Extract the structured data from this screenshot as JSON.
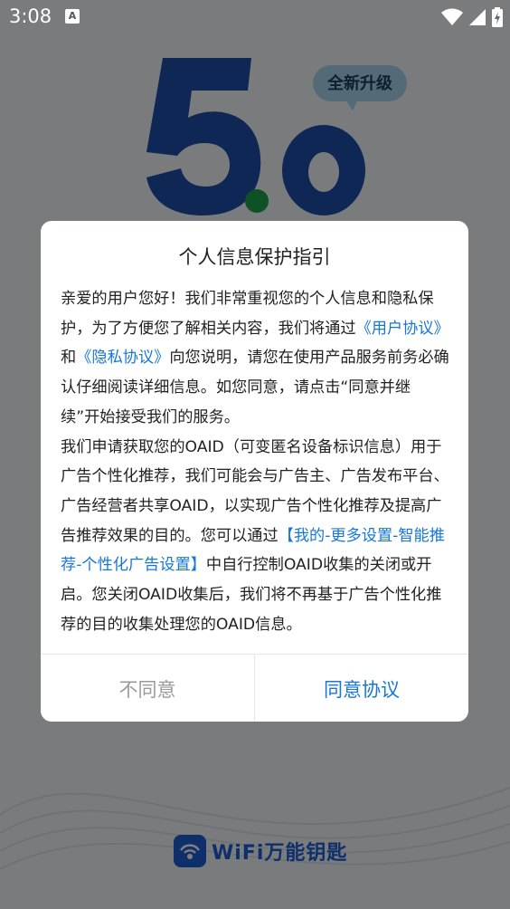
{
  "status_bar": {
    "time": "3:08",
    "notification_badge": "A"
  },
  "splash": {
    "logo_number": "5.0",
    "upgrade_badge": "全新升级",
    "brand_name": "WiFi万能钥匙",
    "colors": {
      "brand": "#1f5fd6",
      "dot": "#1aa34a"
    }
  },
  "dialog": {
    "title": "个人信息保护指引",
    "p1_intro": "亲爱的用户您好！我们非常重视您的个人信息和隐私保护，为了方便您了解相关内容，我们将通过",
    "link_user_agreement": "《用户协议》",
    "p1_and": "和",
    "link_privacy": "《隐私协议》",
    "p1_rest": "向您说明，请您在使用产品服务前务必确认仔细阅读详细信息。如您同意，请点击“同意并继续”开始接受我们的服务。",
    "p2_start": "我们申请获取您的OAID（可变匿名设备标识信息）用于广告个性化推荐，我们可能会与广告主、广告发布平台、广告经营者共享OAID，以实现广告个性化推荐及提高广告推荐效果的目的。您可以通过",
    "p2_setting_path": "【我的-更多设置-智能推荐-个性化广告设置】",
    "p2_rest": "中自行控制OAID收集的关闭或开启。您关闭OAID收集后，我们将不再基于广告个性化推荐的目的收集处理您的OAID信息。",
    "disagree_label": "不同意",
    "agree_label": "同意协议",
    "colors": {
      "link": "#1677d8",
      "disagree": "#9a9a9a"
    }
  }
}
